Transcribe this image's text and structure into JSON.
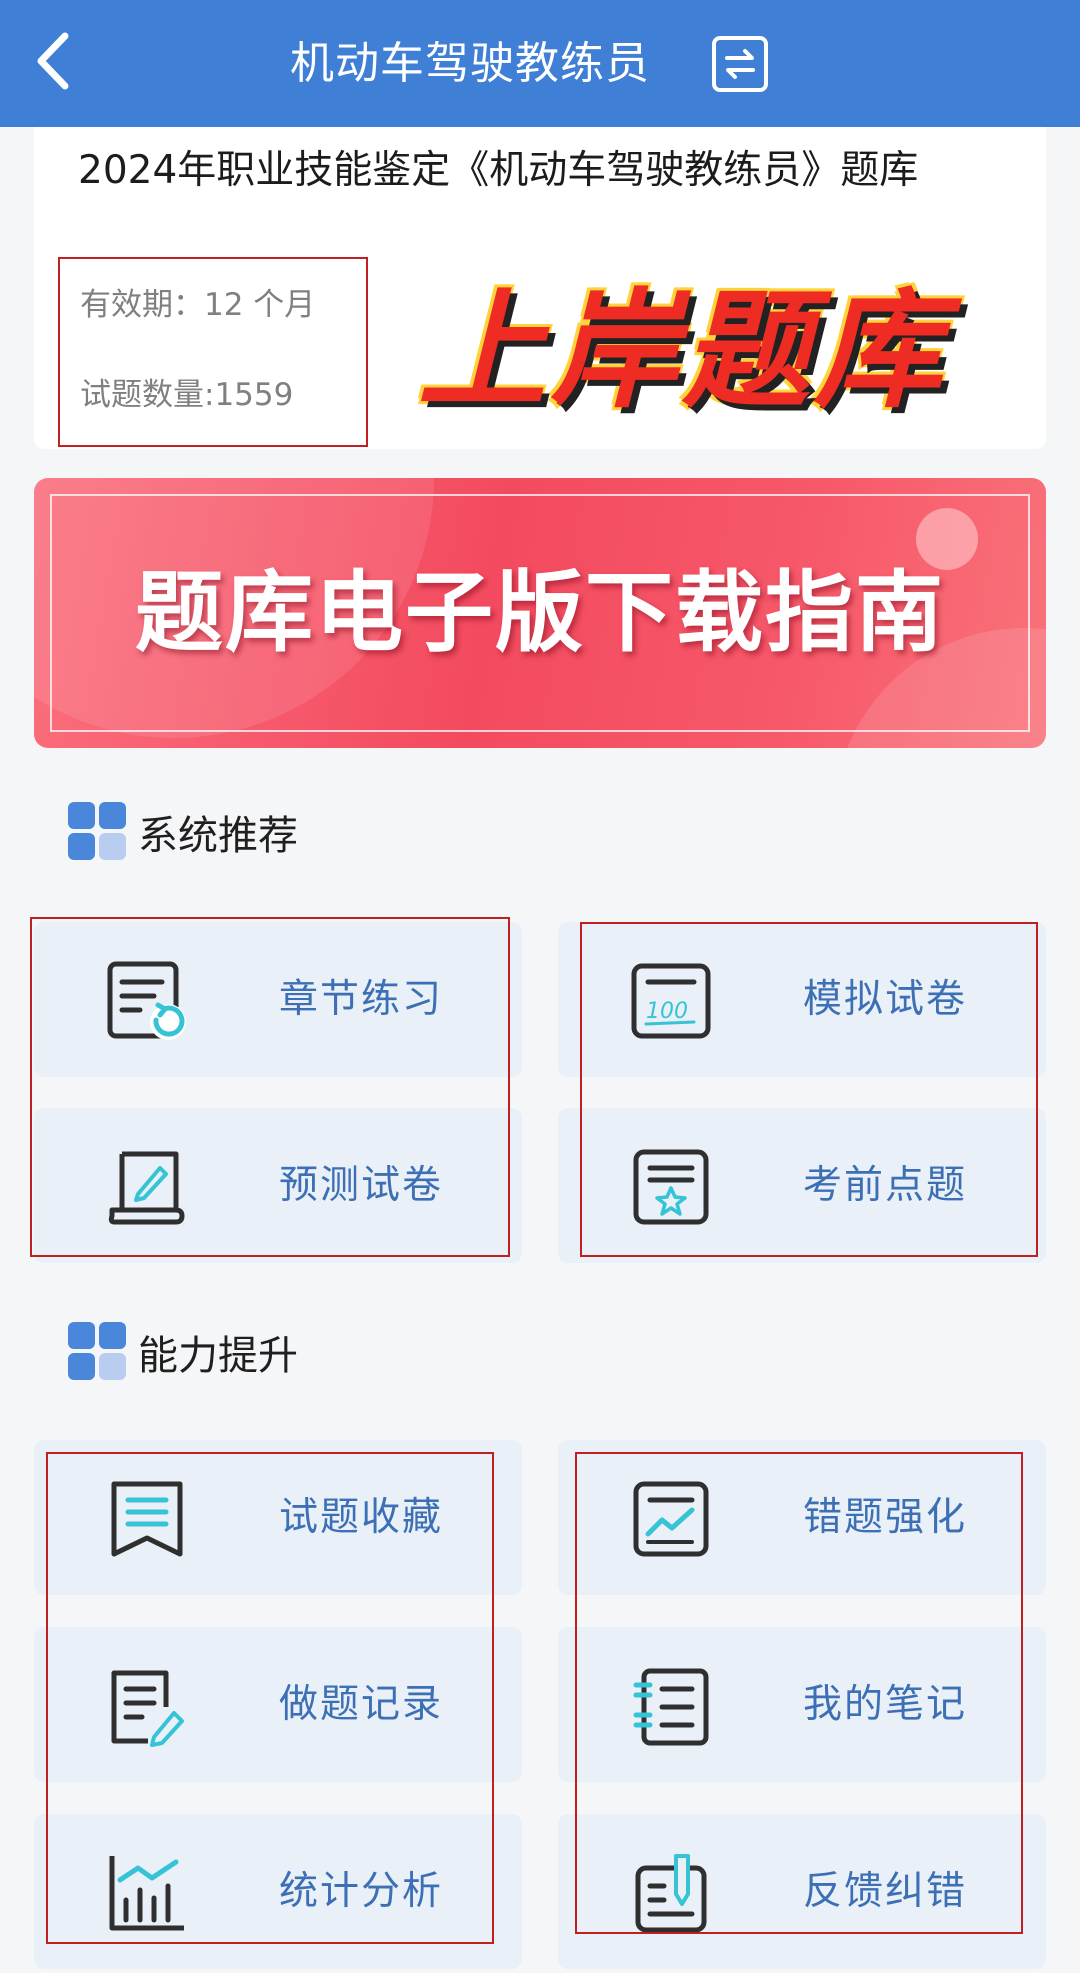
{
  "header": {
    "title": "机动车驾驶教练员",
    "back_icon": "chevron-left-icon",
    "switch_icon": "swap-icon"
  },
  "exam_card": {
    "title": "2024年职业技能鉴定《机动车驾驶教练员》题库",
    "validity": "有效期：12 个月",
    "question_count": "试题数量:1559",
    "stamp_text": "上岸题库"
  },
  "banner": {
    "text": "题库电子版下载指南"
  },
  "sections": [
    {
      "title": "系统推荐",
      "items": [
        {
          "label": "章节练习",
          "icon": "chapter-refresh-icon"
        },
        {
          "label": "模拟试卷",
          "icon": "score-100-icon"
        },
        {
          "label": "预测试卷",
          "icon": "scroll-pen-icon"
        },
        {
          "label": "考前点题",
          "icon": "star-doc-icon"
        }
      ]
    },
    {
      "title": "能力提升",
      "items": [
        {
          "label": "试题收藏",
          "icon": "bookmark-icon"
        },
        {
          "label": "错题强化",
          "icon": "trend-doc-icon"
        },
        {
          "label": "做题记录",
          "icon": "doc-pen-icon"
        },
        {
          "label": "我的笔记",
          "icon": "notebook-icon"
        },
        {
          "label": "统计分析",
          "icon": "bar-chart-icon"
        },
        {
          "label": "反馈纠错",
          "icon": "feedback-pen-icon"
        }
      ]
    }
  ],
  "colors": {
    "header_bg": "#3f7fd6",
    "tile_bg": "#e9f0f8",
    "tile_text": "#3d6fb5",
    "icon_accent": "#36c3d6",
    "highlight_box": "#c02020",
    "stamp_red": "#ee2c24"
  }
}
